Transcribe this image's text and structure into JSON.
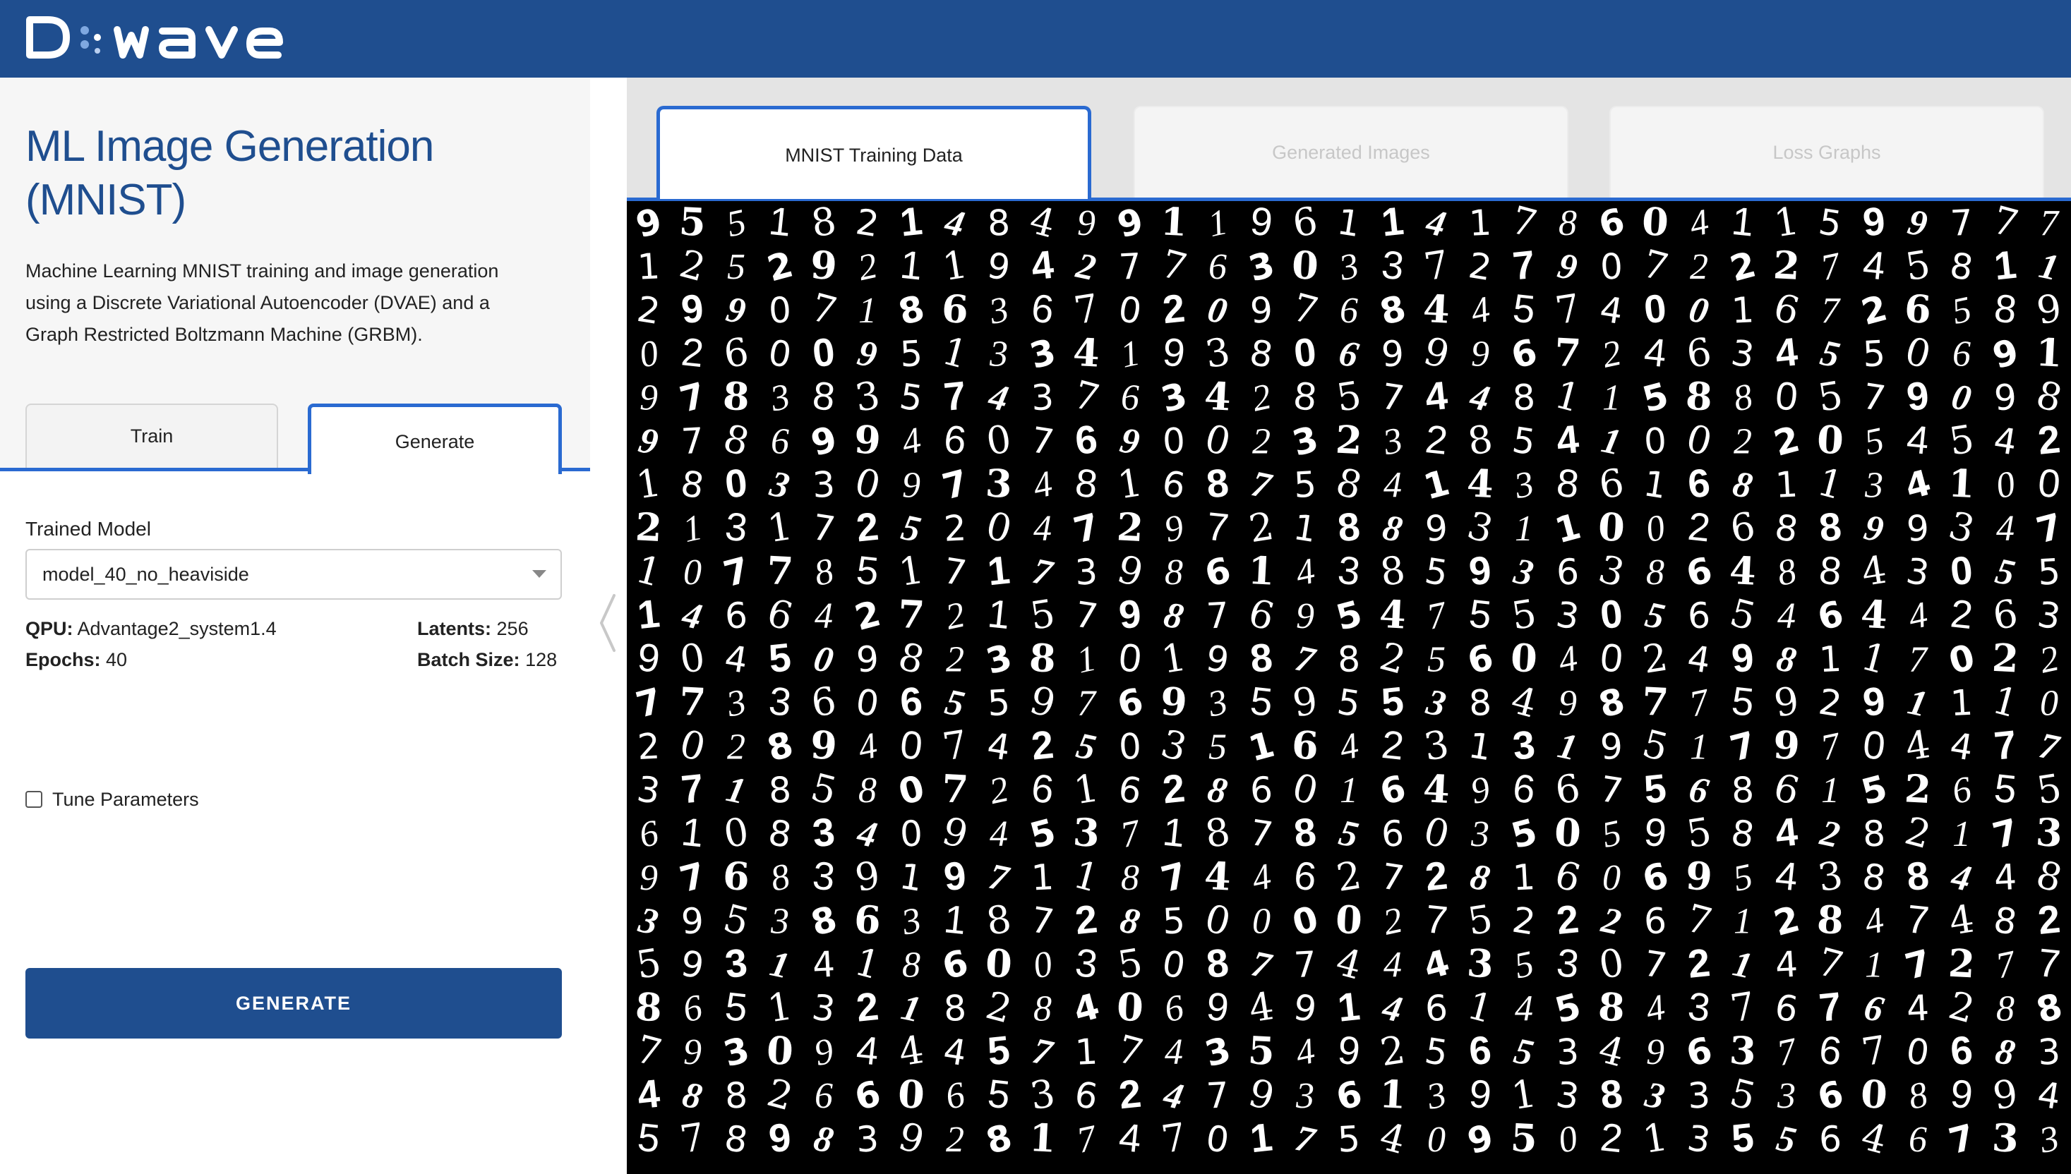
{
  "header": {
    "logo_text": "D:WAVE",
    "brand_color": "#1f4e8f",
    "accent_color": "#2a6ad1"
  },
  "sidebar": {
    "title": "ML Image Generation (MNIST)",
    "description": "Machine Learning MNIST training and image generation using a Discrete Variational Autoencoder (DVAE) and a Graph Restricted Boltzmann Machine (GRBM).",
    "tabs": [
      {
        "label": "Train",
        "active": false
      },
      {
        "label": "Generate",
        "active": true
      }
    ],
    "trained_model": {
      "label": "Trained Model",
      "value": "model_40_no_heaviside"
    },
    "info": {
      "qpu_label": "QPU:",
      "qpu_value": "Advantage2_system1.4",
      "latents_label": "Latents:",
      "latents_value": "256",
      "epochs_label": "Epochs:",
      "epochs_value": "40",
      "batch_label": "Batch Size:",
      "batch_value": "128"
    },
    "tune_parameters": {
      "label": "Tune Parameters",
      "checked": false
    },
    "generate_button": "GENERATE",
    "collapse_icon": "chevron-left-icon"
  },
  "main": {
    "tabs": [
      {
        "label": "MNIST Training Data",
        "active": true
      },
      {
        "label": "Generated Images",
        "active": false
      },
      {
        "label": "Loss Graphs",
        "active": false
      }
    ],
    "digit_rows": [
      "955182148499119611417860411599777",
      "125292119427763033727907222745811",
      "299071863670209768445740016726589",
      "026009513341938069996724634550691",
      "978383574376342857448115880579098",
      "978699460769002323285410022054542",
      "180330973481687584143861681134100",
      "213172520472972188931100268899347",
      "107785171739861438593638648843055",
      "146642721579876954755305654644263",
      "904509823810198782560402498117022",
      "773360655976935955384987759291110",
      "202894074250351642313195179704477",
      "371858072616286016496675686152655",
      "610834094537187856035059584282173",
      "976839197118744627281606954388448",
      "395386318728500002752226712847482",
      "593141860035087744435307214717277",
      "865132182840694914614584376764288",
      "793094445717435492565349637670683",
      "488266065362479361391383353608994",
      "578983928174701754095021355646733"
    ]
  }
}
